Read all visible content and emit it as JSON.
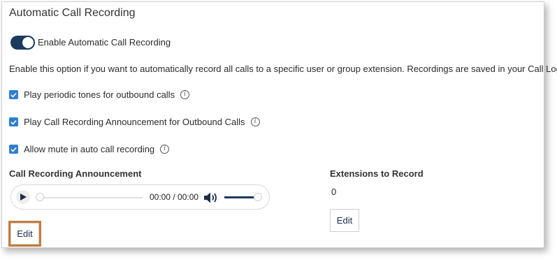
{
  "panel": {
    "title": "Automatic Call Recording",
    "toggle": {
      "label": "Enable Automatic Call Recording",
      "on": true
    },
    "description": "Enable this option if you want to automatically record all calls to a specific user or group extension. Recordings are saved in your Call Log.",
    "options": [
      {
        "label": "Play periodic tones for outbound calls",
        "checked": true,
        "icon": "info-icon"
      },
      {
        "label": "Play Call Recording Announcement for Outbound Calls",
        "checked": true,
        "icon": "info-icon"
      },
      {
        "label": "Allow mute in auto call recording",
        "checked": true,
        "icon": "info-icon"
      }
    ]
  },
  "announcement": {
    "heading": "Call Recording Announcement",
    "player": {
      "time": "00:00 / 00:00",
      "progress": 0,
      "volume": 1.0,
      "icons": [
        "play-icon",
        "volume-icon"
      ]
    },
    "edit_label": "Edit"
  },
  "extensions": {
    "heading": "Extensions to Record",
    "count": "0",
    "edit_label": "Edit"
  },
  "colors": {
    "accent": "#1b3a5c",
    "checkbox": "#2f7fd1",
    "highlight": "#c87b3a"
  }
}
